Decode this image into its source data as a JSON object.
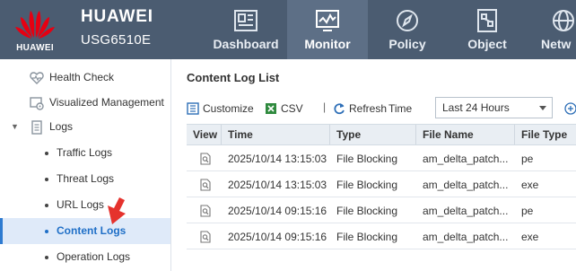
{
  "brand": {
    "logo_text": "HUAWEI",
    "name": "HUAWEI",
    "model": "USG6510E",
    "logo_color": "#e60012"
  },
  "nav": {
    "tabs": [
      {
        "label": "Dashboard",
        "icon": "dashboard-icon",
        "active": false
      },
      {
        "label": "Monitor",
        "icon": "monitor-icon",
        "active": true
      },
      {
        "label": "Policy",
        "icon": "policy-compass-icon",
        "active": false
      },
      {
        "label": "Object",
        "icon": "object-icon",
        "active": false
      },
      {
        "label": "Netw",
        "icon": "network-globe-icon",
        "active": false
      }
    ]
  },
  "sidebar": {
    "items": [
      {
        "label": "Health Check",
        "icon": "heart-pulse-icon"
      },
      {
        "label": "Visualized Management",
        "icon": "visual-gear-icon"
      },
      {
        "label": "Logs",
        "icon": "document-icon",
        "expanded": true
      },
      {
        "label": "Traffic Logs"
      },
      {
        "label": "Threat Logs"
      },
      {
        "label": "URL Logs"
      },
      {
        "label": "Content Logs",
        "selected": true
      },
      {
        "label": "Operation Logs"
      }
    ]
  },
  "content": {
    "title": "Content Log List",
    "toolbar": {
      "customize_label": "Customize",
      "csv_label": "CSV",
      "separator": "|",
      "refresh_label": "Refresh",
      "time_label": "Time",
      "time_value": "Last 24 Hours",
      "add_label": "Ad"
    },
    "table": {
      "columns": [
        "View",
        "Time",
        "Type",
        "File Name",
        "File Type"
      ],
      "rows": [
        {
          "time": "2025/10/14 13:15:03",
          "type": "File Blocking",
          "file_name": "am_delta_patch...",
          "file_type": "pe"
        },
        {
          "time": "2025/10/14 13:15:03",
          "type": "File Blocking",
          "file_name": "am_delta_patch...",
          "file_type": "exe"
        },
        {
          "time": "2025/10/14 09:15:16",
          "type": "File Blocking",
          "file_name": "am_delta_patch...",
          "file_type": "pe"
        },
        {
          "time": "2025/10/14 09:15:16",
          "type": "File Blocking",
          "file_name": "am_delta_patch...",
          "file_type": "exe"
        }
      ]
    }
  },
  "colors": {
    "header_bg": "#4b5c71",
    "active_tab_bg": "#5d6f86",
    "selected_item_bg": "#dfeaf9",
    "accent_blue": "#1f6fc7",
    "cursor_red": "#e5322d"
  }
}
